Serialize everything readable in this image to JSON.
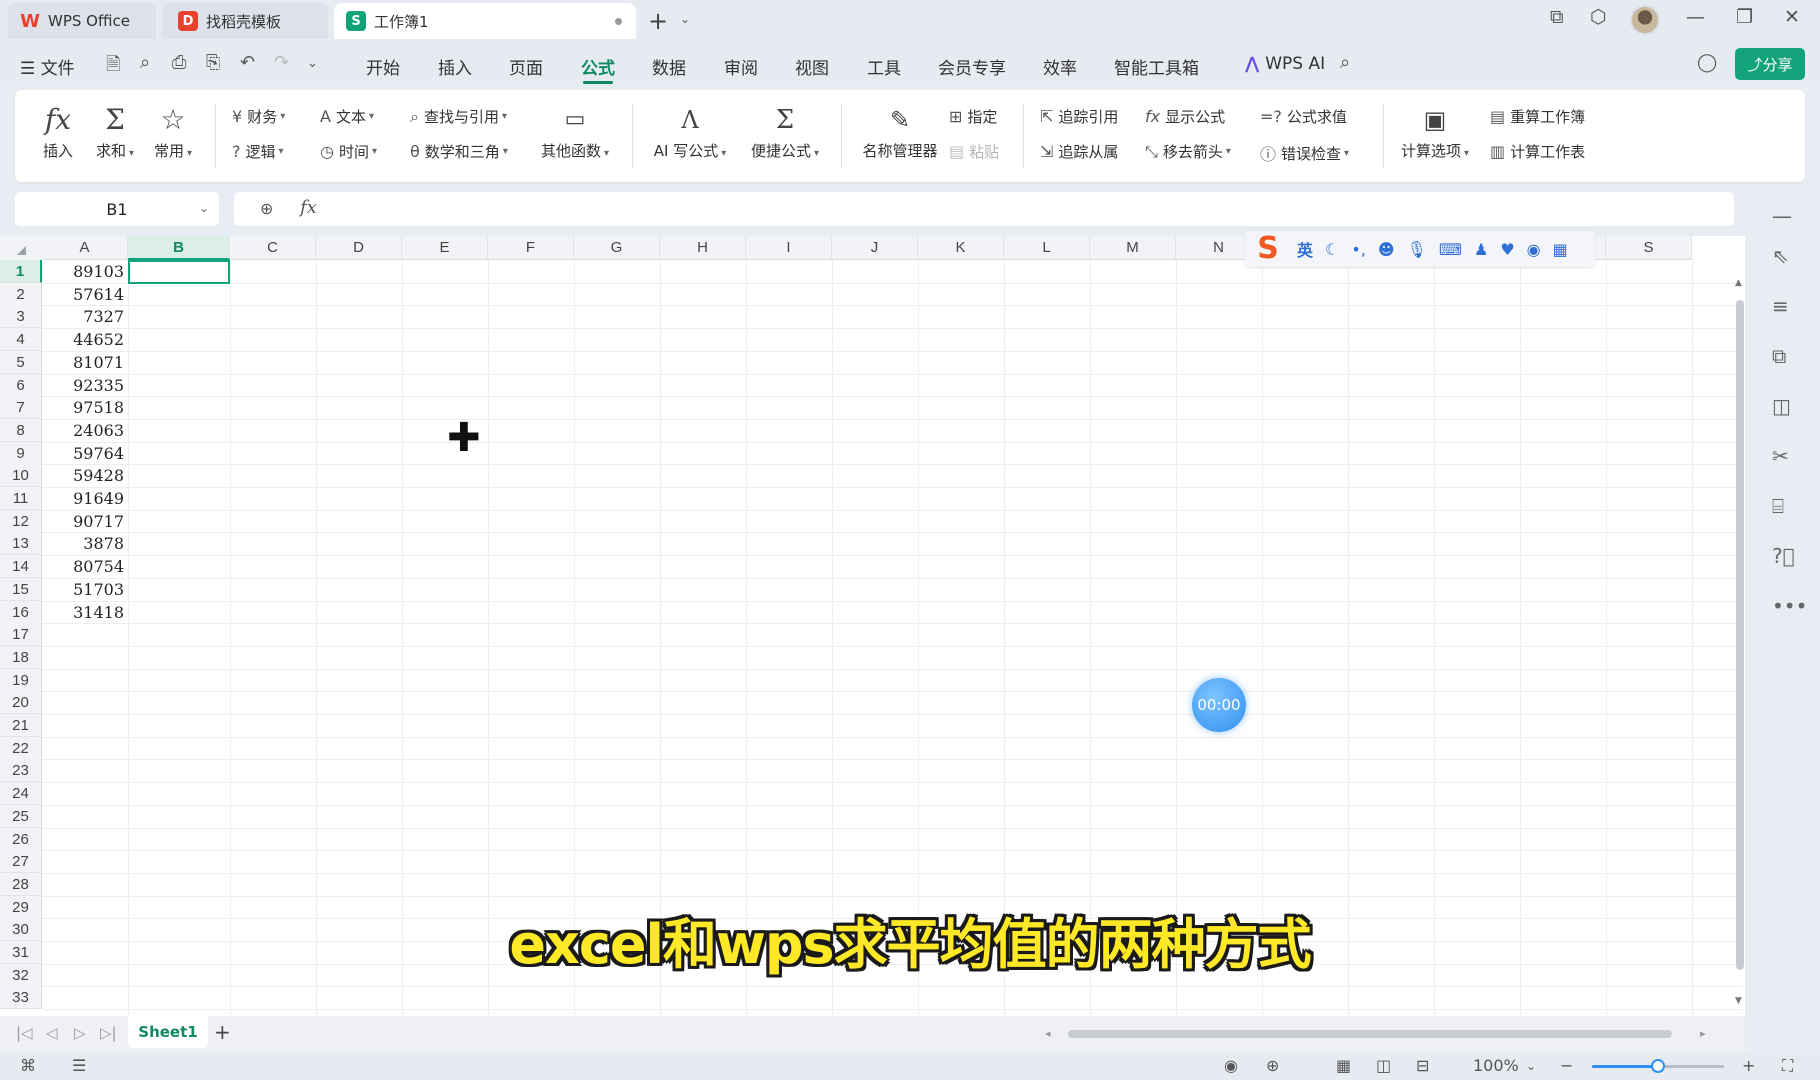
{
  "titlebar": {
    "tabs": [
      {
        "label": "WPS Office",
        "icon": "wps-logo-icon"
      },
      {
        "label": "找稻壳模板",
        "icon": "docer-icon"
      },
      {
        "label": "工作簿1",
        "icon": "spreadsheet-icon"
      }
    ],
    "new_tab": "+"
  },
  "menubar": {
    "file": "文件",
    "items": [
      "开始",
      "插入",
      "页面",
      "公式",
      "数据",
      "审阅",
      "视图",
      "工具",
      "会员专享",
      "效率",
      "智能工具箱"
    ],
    "active": "公式",
    "wps_ai": "WPS AI",
    "share": "分享"
  },
  "ribbon": {
    "big": [
      {
        "label": "插入",
        "icon": "fx-icon"
      },
      {
        "label": "求和",
        "icon": "sigma-icon"
      },
      {
        "label": "常用",
        "icon": "star-icon"
      }
    ],
    "functions": [
      "财务",
      "文本",
      "查找与引用",
      "逻辑",
      "时间",
      "数学和三角"
    ],
    "other_functions": "其他函数",
    "ai_formula": "AI 写公式",
    "quick_formula": "便捷公式",
    "name_manager": "名称管理器",
    "assign": "指定",
    "paste": "粘贴",
    "trace_precedents": "追踪引用",
    "trace_dependents": "追踪从属",
    "show_formulas": "显示公式",
    "remove_arrows": "移去箭头",
    "evaluate_formula": "公式求值",
    "error_check": "错误检查",
    "calc_options": "计算选项",
    "recalc_workbook": "重算工作簿",
    "calc_sheet": "计算工作表"
  },
  "formula_bar": {
    "name_box": "B1",
    "fx": "fx",
    "value": ""
  },
  "grid": {
    "columns": [
      "A",
      "B",
      "C",
      "D",
      "E",
      "F",
      "G",
      "H",
      "I",
      "J",
      "K",
      "L",
      "M",
      "N",
      "O",
      "P",
      "Q",
      "R",
      "S"
    ],
    "selected_column": "B",
    "rows": [
      "1",
      "2",
      "3",
      "4",
      "5",
      "6",
      "7",
      "8",
      "9",
      "10",
      "11",
      "12",
      "13",
      "14",
      "15",
      "16",
      "17",
      "18",
      "19",
      "20",
      "21",
      "22",
      "23",
      "24",
      "25",
      "26",
      "27",
      "28",
      "29",
      "30",
      "31",
      "32",
      "33"
    ],
    "selected_row": "1",
    "column_a_values": [
      "89103",
      "57614",
      "7327",
      "44652",
      "81071",
      "92335",
      "97518",
      "24063",
      "59764",
      "59428",
      "91649",
      "90717",
      "3878",
      "80754",
      "51703",
      "31418"
    ]
  },
  "ime": {
    "mode": "英"
  },
  "timer": "00:00",
  "subtitle": "excel和wps求平均值的两种方式",
  "sheets": {
    "tabs": [
      "Sheet1"
    ],
    "add": "+"
  },
  "statusbar": {
    "zoom": "100%",
    "zoom_level": 0.5
  },
  "colors": {
    "accent": "#12a37a",
    "subtitle": "#ffe826",
    "timer": "#2e8ff0"
  }
}
